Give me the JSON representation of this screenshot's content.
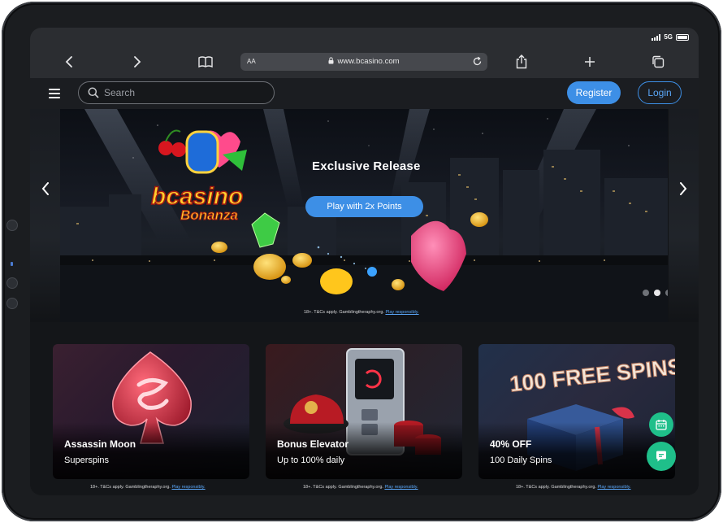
{
  "status": {
    "network": "5G"
  },
  "browser": {
    "text_size_label": "AA",
    "url": "www.bcasino.com"
  },
  "header": {
    "search_placeholder": "Search",
    "register_label": "Register",
    "login_label": "Login"
  },
  "hero": {
    "logo_text_1": "bcasino",
    "logo_text_2": "Bonanza",
    "title": "Exclusive Release",
    "cta_label": "Play with 2x Points",
    "active_slide": 2,
    "slide_count": 4,
    "disclaimer": "18+. T&Cs apply. Gamblingtheraphy.org.",
    "disclaimer_link": "Play responsibly."
  },
  "promos": [
    {
      "title": "Assassin Moon",
      "subtitle": "Superspins",
      "disclaimer": "18+. T&Cs apply. Gamblingtheraphy.org.",
      "disclaimer_link": "Play responsibly."
    },
    {
      "title": "Bonus Elevator",
      "subtitle": "Up to 100% daily",
      "disclaimer": "18+. T&Cs apply. Gamblingtheraphy.org.",
      "disclaimer_link": "Play responsibly."
    },
    {
      "title": "40% OFF",
      "subtitle": "100 Daily Spins",
      "art_text": "100 FREE SPINS",
      "disclaimer": "18+. T&Cs apply. Gamblingtheraphy.org.",
      "disclaimer_link": "Play responsibly."
    }
  ],
  "colors": {
    "accent": "#3d8fe6",
    "fab_green": "#1fbf8a",
    "header_bg": "#1b1d21"
  },
  "icons": {
    "back": "chevron-left-icon",
    "forward": "chevron-right-icon",
    "bookmarks": "book-icon",
    "share": "share-icon",
    "new_tab": "plus-icon",
    "tabs": "tabs-icon",
    "calendar_fab": "calendar-icon",
    "chat_fab": "chat-icon"
  }
}
